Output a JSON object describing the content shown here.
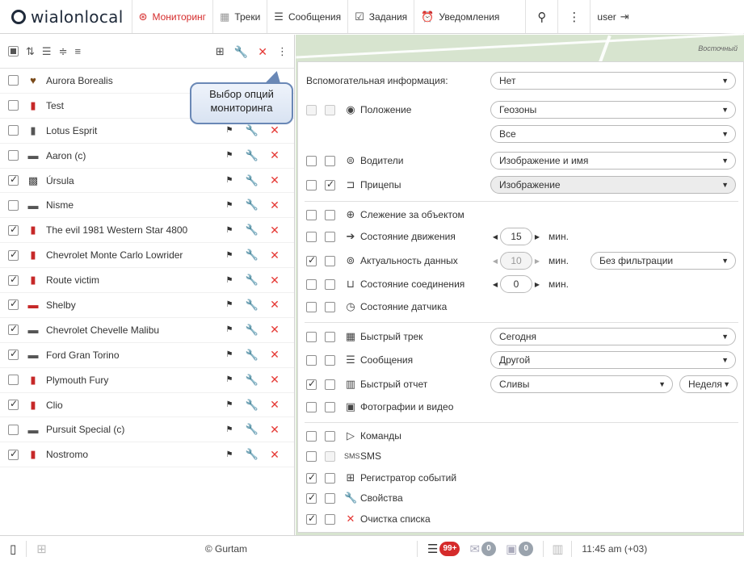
{
  "topbar": {
    "logo": {
      "brand": "wialon",
      "suffix": "local"
    },
    "tabs": [
      {
        "label": "Мониторинг",
        "icon": "globe-icon"
      },
      {
        "label": "Треки",
        "icon": "track-icon"
      },
      {
        "label": "Сообщения",
        "icon": "messages-icon"
      },
      {
        "label": "Задания",
        "icon": "tasks-icon"
      },
      {
        "label": "Уведомления",
        "icon": "alarm-icon"
      }
    ],
    "user": "user"
  },
  "units": [
    {
      "name": "Aurora Borealis",
      "checked": false,
      "icon": "pin-icon"
    },
    {
      "name": "Test",
      "checked": false,
      "icon": "phone-red-icon"
    },
    {
      "name": "Lotus Esprit",
      "checked": false,
      "icon": "phone-icon"
    },
    {
      "name": "Aaron (c)",
      "checked": false,
      "icon": "car-icon"
    },
    {
      "name": "Úrsula",
      "checked": true,
      "icon": "photo-icon"
    },
    {
      "name": "Nisme",
      "checked": false,
      "icon": "car-icon"
    },
    {
      "name": "The evil 1981 Western Star 4800",
      "checked": true,
      "icon": "phone-red-icon"
    },
    {
      "name": "Chevrolet Monte Carlo Lowrider",
      "checked": true,
      "icon": "phone-red-icon"
    },
    {
      "name": "Route victim",
      "checked": true,
      "icon": "phone-red-icon"
    },
    {
      "name": "Shelby",
      "checked": true,
      "icon": "car-red-icon"
    },
    {
      "name": "Chevrolet Chevelle Malibu",
      "checked": true,
      "icon": "car-icon"
    },
    {
      "name": "Ford Gran Torino",
      "checked": true,
      "icon": "car-icon"
    },
    {
      "name": "Plymouth Fury",
      "checked": false,
      "icon": "phone-red-icon"
    },
    {
      "name": "Clio",
      "checked": true,
      "icon": "phone-red-icon"
    },
    {
      "name": "Pursuit Special (c)",
      "checked": false,
      "icon": "car-icon"
    },
    {
      "name": "Nostromo",
      "checked": true,
      "icon": "phone-red-icon"
    }
  ],
  "tooltip": {
    "line1": "Выбор опций",
    "line2": "мониторинга"
  },
  "map": {
    "label": "Восточный"
  },
  "options": {
    "aux_label": "Вспомогательная информация:",
    "aux_value": "Нет",
    "position": {
      "label": "Положение",
      "select1": "Геозоны",
      "select2": "Все"
    },
    "drivers": {
      "label": "Водители",
      "select": "Изображение и имя"
    },
    "trailers": {
      "label": "Прицепы",
      "select": "Изображение"
    },
    "tracking": {
      "label": "Слежение за объектом"
    },
    "motion": {
      "label": "Состояние движения",
      "value": "15",
      "unit": "мин."
    },
    "actuality": {
      "label": "Актуальность данных",
      "value": "10",
      "unit": "мин.",
      "select": "Без фильтрации"
    },
    "connection": {
      "label": "Состояние соединения",
      "value": "0",
      "unit": "мин."
    },
    "sensor": {
      "label": "Состояние датчика"
    },
    "quick_track": {
      "label": "Быстрый трек",
      "select": "Сегодня"
    },
    "messages": {
      "label": "Сообщения",
      "select": "Другой"
    },
    "quick_report": {
      "label": "Быстрый отчет",
      "select": "Сливы",
      "select2": "Неделя"
    },
    "photos": {
      "label": "Фотографии и видео"
    },
    "commands": {
      "label": "Команды"
    },
    "sms": {
      "label": "SMS"
    },
    "event_registrar": {
      "label": "Регистратор событий"
    },
    "properties": {
      "label": "Свойства"
    },
    "clear_list": {
      "label": "Очистка списка"
    }
  },
  "bottombar": {
    "copyright": "© Gurtam",
    "badge_events": "99+",
    "badge_mail": "0",
    "badge_images": "0",
    "time": "11:45 am (+03)"
  },
  "colors": {
    "accent": "#d52b2b",
    "danger": "#e53935",
    "map": "#d7e4cf"
  }
}
